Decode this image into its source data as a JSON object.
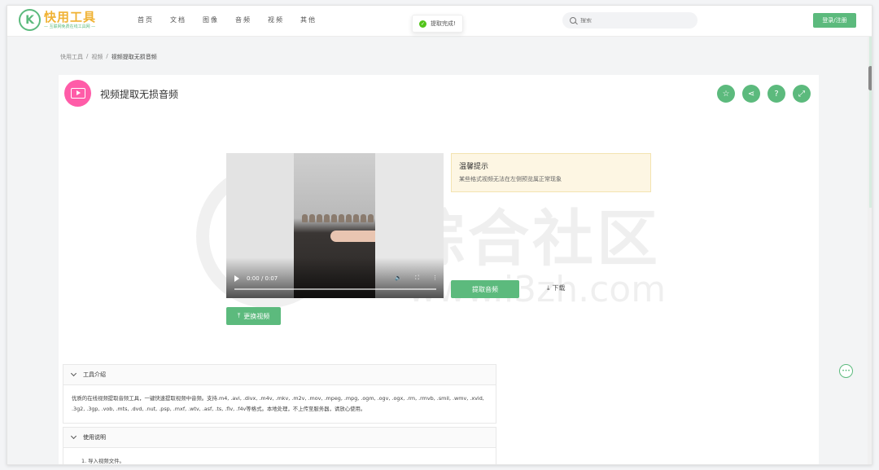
{
  "header": {
    "logo_title": "快用工具",
    "logo_subtitle": "— 互联网免费在线工具网 —",
    "nav": [
      "首页",
      "文档",
      "图像",
      "音频",
      "视频",
      "其他"
    ],
    "search_placeholder": "搜索",
    "login_label": "登录/注册"
  },
  "toast": {
    "message": "提取完成!"
  },
  "breadcrumb": [
    "快用工具",
    "视频",
    "视频提取无损音频"
  ],
  "tool": {
    "title": "视频提取无损音频",
    "actions": [
      "star-icon",
      "share-icon",
      "help-icon",
      "fullscreen-icon"
    ]
  },
  "video": {
    "time": "0:00 / 0:07"
  },
  "tip": {
    "title": "温馨提示",
    "text": "某些格式视频无法在左侧预览属正常现象"
  },
  "buttons": {
    "extract": "提取音频",
    "download": "下载",
    "replace": "更换视频"
  },
  "watermark": {
    "text": "哩综合社区",
    "url": "www.i3zh.com"
  },
  "sections": [
    {
      "title": "工具介绍",
      "body": "优质的在线视频提取音频工具，一键快速提取视频中音频。支持.m4, .avi, .divx, .m4v, .mkv, .m2v, .mov, .mpeg, .mpg, .ogm, .ogv, .ogx, .rm, .rmvb, .smil, .wmv, .xvid, .3g2, .3gp, .vob, .mts, .dvd, .nut, .psp, .mxf, .wtv, .asf, .ts, .flv, .f4v等格式。本地处理，不上传至服务器，请放心使用。"
    },
    {
      "title": "使用说明",
      "body": "1. 导入视频文件。"
    }
  ],
  "colors": {
    "accent": "#5cba7d",
    "tool_icon": "#ff5ca8",
    "logo_title": "#f0b233"
  }
}
